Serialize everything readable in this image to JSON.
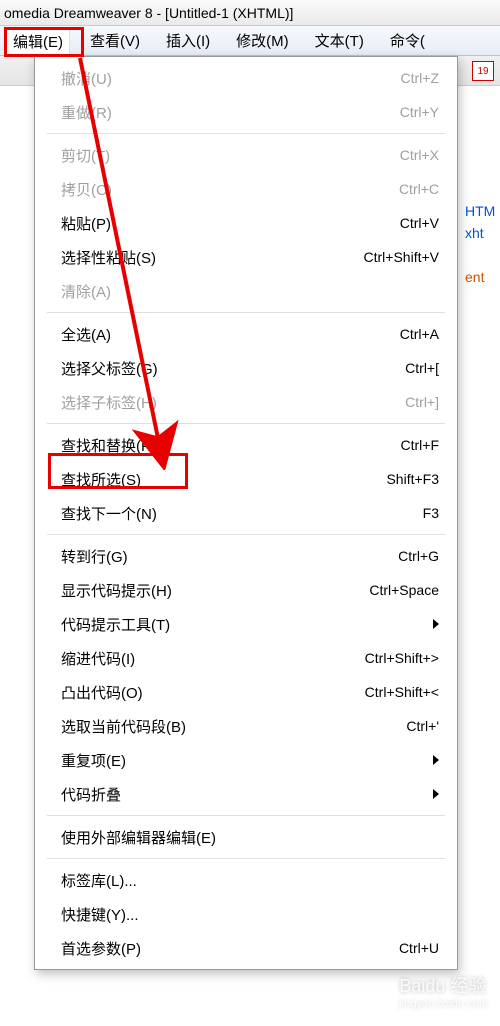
{
  "title": "omedia Dreamweaver 8 - [Untitled-1 (XHTML)]",
  "menubar": {
    "edit": "编辑(E)",
    "view": "查看(V)",
    "insert": "插入(I)",
    "modify": "修改(M)",
    "text": "文本(T)",
    "commands": "命令("
  },
  "calendar_icon": "19",
  "menu": {
    "undo": {
      "label": "撤消(U)",
      "shortcut": "Ctrl+Z"
    },
    "redo": {
      "label": "重做(R)",
      "shortcut": "Ctrl+Y"
    },
    "cut": {
      "label": "剪切(T)",
      "shortcut": "Ctrl+X"
    },
    "copy": {
      "label": "拷贝(C)",
      "shortcut": "Ctrl+C"
    },
    "paste": {
      "label": "粘贴(P)",
      "shortcut": "Ctrl+V"
    },
    "paste_special": {
      "label": "选择性粘贴(S)",
      "shortcut": "Ctrl+Shift+V"
    },
    "clear": {
      "label": "清除(A)",
      "shortcut": ""
    },
    "select_all": {
      "label": "全选(A)",
      "shortcut": "Ctrl+A"
    },
    "select_parent": {
      "label": "选择父标签(G)",
      "shortcut": "Ctrl+["
    },
    "select_child": {
      "label": "选择子标签(H)",
      "shortcut": "Ctrl+]"
    },
    "find_replace": {
      "label": "查找和替换(F)",
      "shortcut": "Ctrl+F"
    },
    "find_selection": {
      "label": "查找所选(S)",
      "shortcut": "Shift+F3"
    },
    "find_next": {
      "label": "查找下一个(N)",
      "shortcut": "F3"
    },
    "goto_line": {
      "label": "转到行(G)",
      "shortcut": "Ctrl+G"
    },
    "code_hints": {
      "label": "显示代码提示(H)",
      "shortcut": "Ctrl+Space"
    },
    "code_hint_tools": {
      "label": "代码提示工具(T)",
      "shortcut": ""
    },
    "indent": {
      "label": "缩进代码(I)",
      "shortcut": "Ctrl+Shift+>"
    },
    "outdent": {
      "label": "凸出代码(O)",
      "shortcut": "Ctrl+Shift+<"
    },
    "select_snippet": {
      "label": "选取当前代码段(B)",
      "shortcut": "Ctrl+'"
    },
    "repeat": {
      "label": "重复项(E)",
      "shortcut": ""
    },
    "code_collapse": {
      "label": "代码折叠",
      "shortcut": ""
    },
    "ext_editor": {
      "label": "使用外部编辑器编辑(E)",
      "shortcut": ""
    },
    "tag_lib": {
      "label": "标签库(L)...",
      "shortcut": ""
    },
    "shortcuts": {
      "label": "快捷键(Y)...",
      "shortcut": ""
    },
    "prefs": {
      "label": "首选参数(P)",
      "shortcut": "Ctrl+U"
    }
  },
  "peek": {
    "l1": "HTM",
    "l2": "xht",
    "l3": "ent"
  },
  "watermark": {
    "main": "Baidu 经验",
    "sub": "jingyan.baidu.com"
  }
}
